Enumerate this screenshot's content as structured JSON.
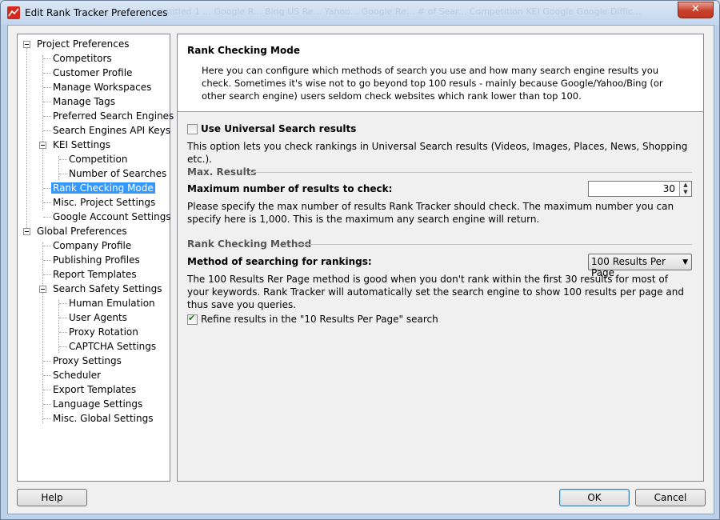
{
  "window": {
    "title": "Edit Rank Tracker Preferences",
    "close_glyph": "✕",
    "background_tabs_text": "Untitled 1 ... Google R... Bing US Re... Yahoo... Google Re... # of Sear... Competition   KEI   Google   Google Diffic..."
  },
  "tree": {
    "items": [
      {
        "label": "Project Preferences"
      },
      {
        "label": "Competitors"
      },
      {
        "label": "Customer Profile"
      },
      {
        "label": "Manage Workspaces"
      },
      {
        "label": "Manage Tags"
      },
      {
        "label": "Preferred Search Engines"
      },
      {
        "label": "Search Engines API Keys"
      },
      {
        "label": "KEI Settings"
      },
      {
        "label": "Competition"
      },
      {
        "label": "Number of Searches"
      },
      {
        "label": "Rank Checking Mode"
      },
      {
        "label": "Misc. Project Settings"
      },
      {
        "label": "Google Account Settings"
      },
      {
        "label": "Global Preferences"
      },
      {
        "label": "Company Profile"
      },
      {
        "label": "Publishing Profiles"
      },
      {
        "label": "Report Templates"
      },
      {
        "label": "Search Safety Settings"
      },
      {
        "label": "Human Emulation"
      },
      {
        "label": "User Agents"
      },
      {
        "label": "Proxy Rotation"
      },
      {
        "label": "CAPTCHA Settings"
      },
      {
        "label": "Proxy Settings"
      },
      {
        "label": "Scheduler"
      },
      {
        "label": "Export Templates"
      },
      {
        "label": "Language Settings"
      },
      {
        "label": "Misc. Global Settings"
      }
    ],
    "selected": "Rank Checking Mode"
  },
  "panel": {
    "title": "Rank Checking Mode",
    "description": "Here you can configure which methods of search you use and how many search engine results you check. Sometimes it's wise not to go beyond top 100 resuls - mainly because Google/Yahoo/Bing (or other search engine) users seldom check websites which rank lower than top 100.",
    "universal": {
      "label": "Use Universal Search results",
      "checked": false,
      "help": "This option lets you check rankings in Universal Search results (Videos, Images, Places, News, Shopping etc.)."
    },
    "max_results": {
      "section": "Max. Results",
      "label": "Maximum number of results to check:",
      "value": "30",
      "help": "Please specify the max number of results Rank Tracker should check. The maximum number you can specify here is 1,000. This is the maximum any search engine will return."
    },
    "method": {
      "section": "Rank Checking Method",
      "label": "Method of searching for rankings:",
      "selected_option": "100 Results Per Page",
      "help": "The 100 Results Rer Page method is good when you don't rank within the first 30 results for most of your keywords. Rank Tracker will automatically set the search engine to show 100 results per page and thus save you queries."
    },
    "refine": {
      "label": "Refine results in the \"10 Results Per Page\" search",
      "checked": true
    }
  },
  "buttons": {
    "help": "Help",
    "ok": "OK",
    "cancel": "Cancel"
  },
  "colors": {
    "selection": "#3399ff",
    "close_button": "#c7402b",
    "app_icon": "#d42a1e"
  }
}
